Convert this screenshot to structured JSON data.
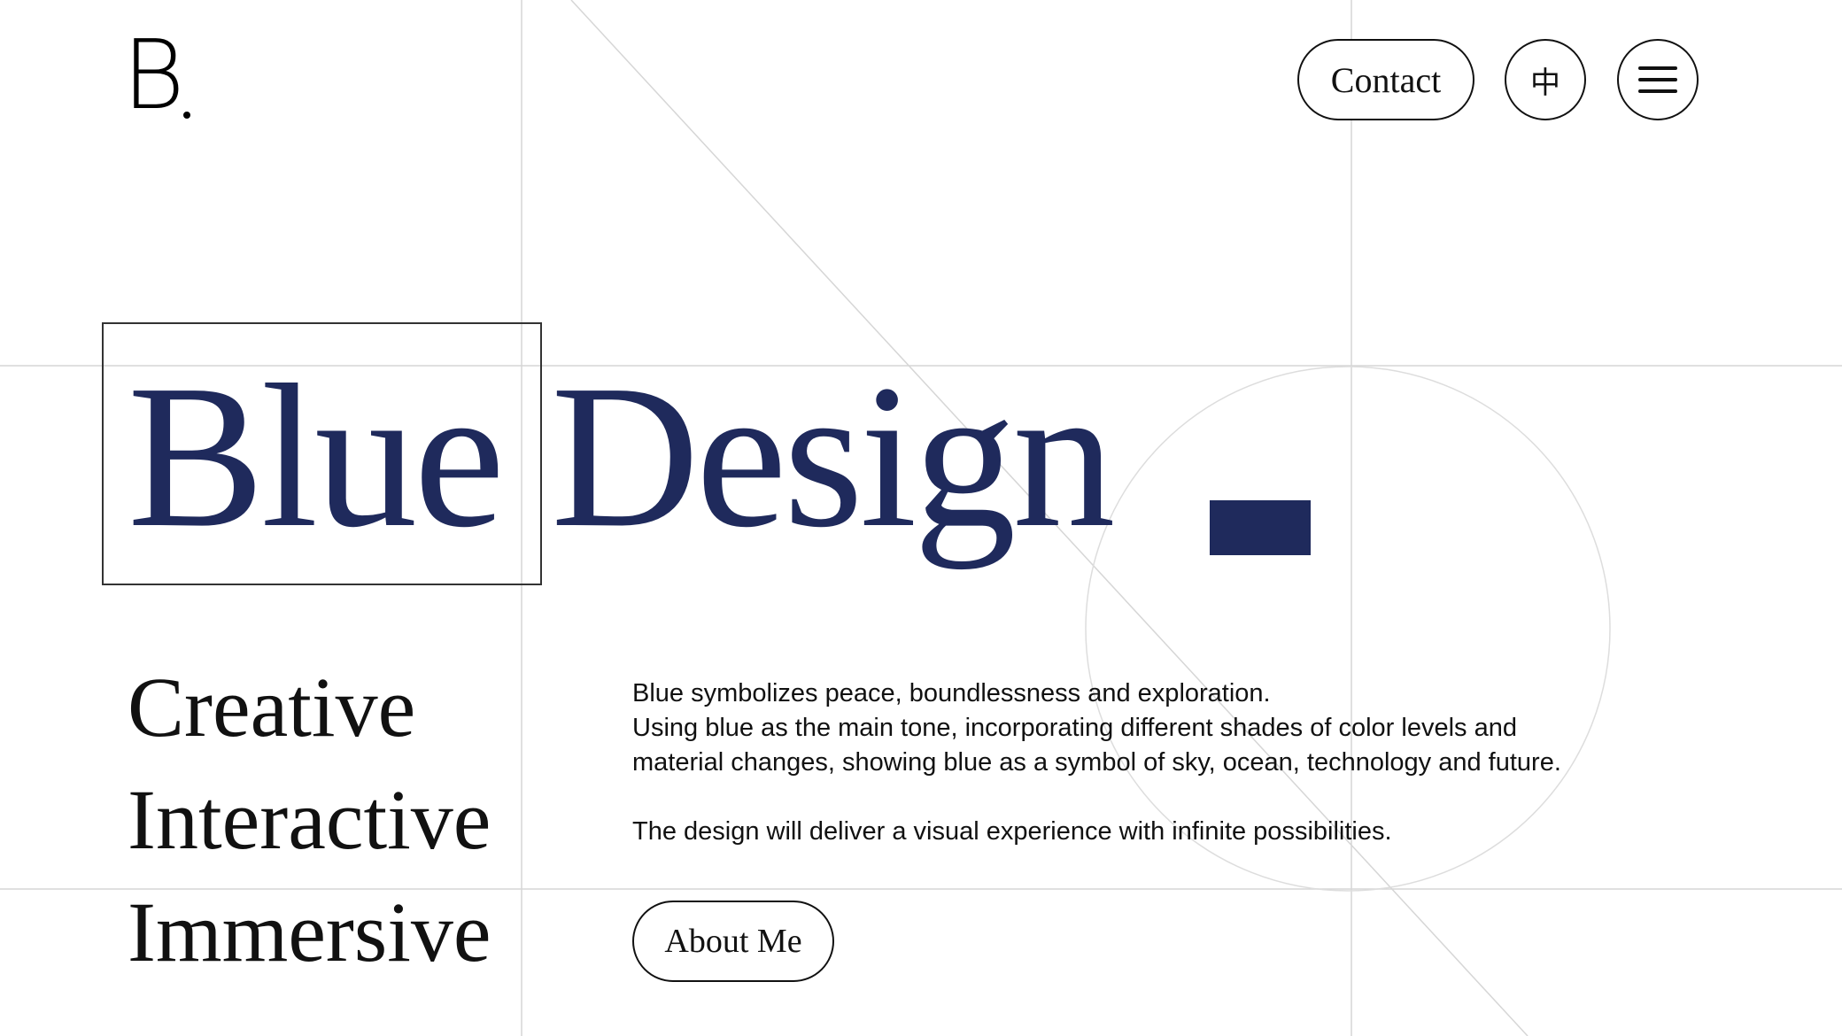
{
  "header": {
    "logo_letter": "B",
    "contact_label": "Contact",
    "language_label": "中",
    "menu_icon": "hamburger-menu-icon"
  },
  "hero": {
    "word1": "Blue",
    "word2": "Design"
  },
  "keywords": [
    "Creative",
    "Interactive",
    "Immersive"
  ],
  "description": {
    "line1": "Blue symbolizes peace, boundlessness and exploration.",
    "line2": "Using blue as the main tone, incorporating different shades of color levels and",
    "line3": "material changes, showing blue as a symbol of sky, ocean, technology and future.",
    "line4": "The design will deliver a visual experience with infinite possibilities."
  },
  "cta": {
    "about_label": "About Me"
  },
  "colors": {
    "brand_blue": "#1f2a5c",
    "text": "#111111",
    "guide": "#d6d6d6",
    "background": "#ffffff"
  }
}
